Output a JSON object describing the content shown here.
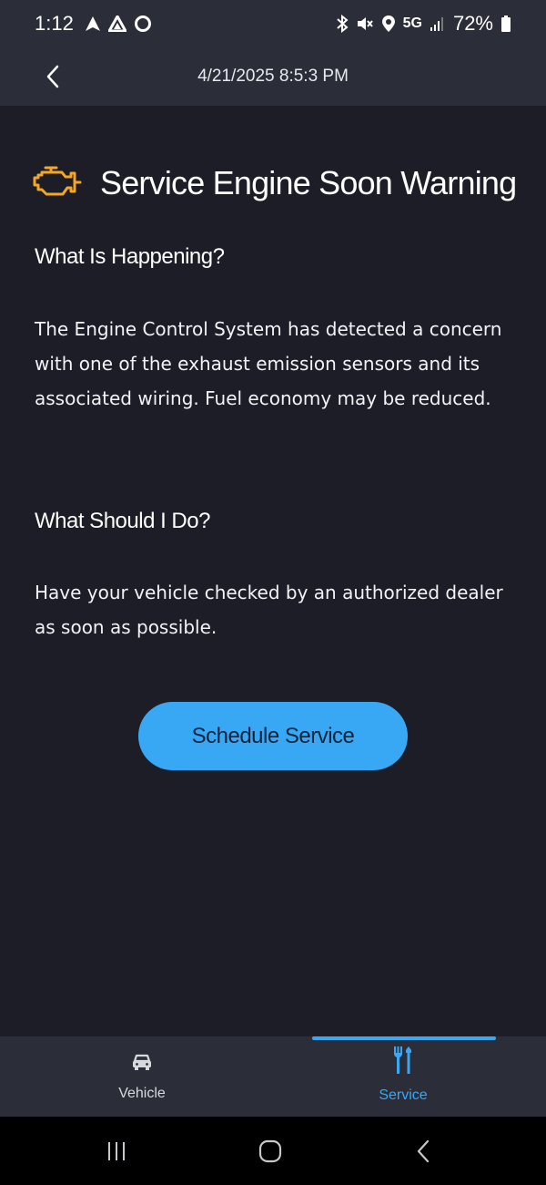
{
  "status_bar": {
    "time": "1:12",
    "network": "5G",
    "battery": "72%"
  },
  "header": {
    "title": "4/21/2025 8:5:3 PM"
  },
  "main": {
    "title": "Service Engine Soon Warning",
    "what_happening_heading": "What Is Happening?",
    "what_happening_text": "The Engine Control System has detected a concern with one of the exhaust emission sensors and its associated wiring. Fuel economy may be reduced.",
    "what_do_heading": "What Should I Do?",
    "what_do_text": "Have your vehicle checked by an authorized dealer as soon as possible.",
    "schedule_button": "Schedule Service",
    "warning_icon": "check-engine-icon",
    "warning_color": "#f5a623"
  },
  "bottom_nav": {
    "items": [
      {
        "label": "Vehicle",
        "icon": "car-icon",
        "active": false
      },
      {
        "label": "Service",
        "icon": "tools-icon",
        "active": true
      }
    ],
    "accent": "#38a8f5"
  },
  "system_nav": {
    "recents": "recents-icon",
    "home": "home-icon",
    "back": "back-icon"
  }
}
